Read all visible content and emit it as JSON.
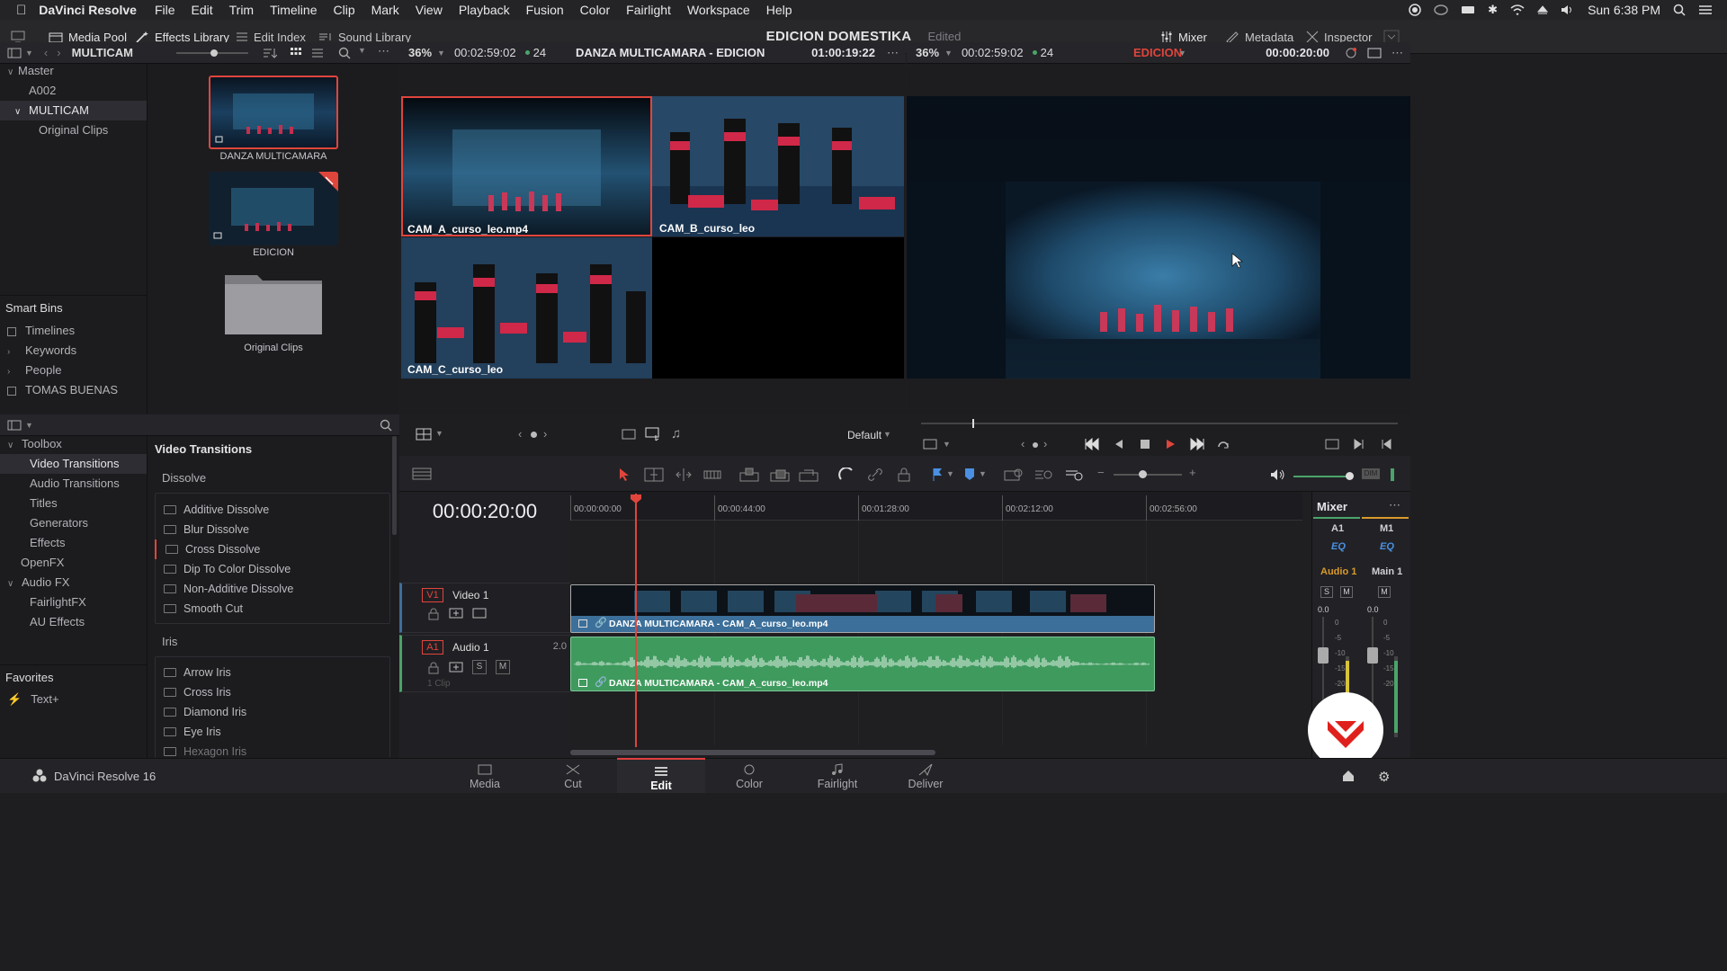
{
  "menubar": {
    "app": "DaVinci Resolve",
    "items": [
      "File",
      "Edit",
      "Trim",
      "Timeline",
      "Clip",
      "Mark",
      "View",
      "Playback",
      "Fusion",
      "Color",
      "Fairlight",
      "Workspace",
      "Help"
    ],
    "clock": "Sun 6:38 PM"
  },
  "toolbar": {
    "media_pool": "Media Pool",
    "effects_library": "Effects Library",
    "edit_index": "Edit Index",
    "sound_library": "Sound Library",
    "project_title": "EDICION DOMESTIKA",
    "project_status": "Edited",
    "mixer": "Mixer",
    "metadata": "Metadata",
    "inspector": "Inspector"
  },
  "media_pool": {
    "bin_name": "MULTICAM",
    "tree": [
      {
        "label": "Master"
      },
      {
        "label": "A002"
      },
      {
        "label": "MULTICAM"
      },
      {
        "label": "Original Clips"
      }
    ],
    "smart_bins_title": "Smart Bins",
    "smart_bins": [
      "Timelines",
      "Keywords",
      "People",
      "TOMAS BUENAS"
    ],
    "clips": [
      "DANZA MULTICAMARA",
      "EDICION",
      "Original Clips"
    ]
  },
  "source_viewer": {
    "zoom": "36%",
    "timecode": "00:02:59:02",
    "fps": "24",
    "title": "DANZA MULTICAMARA - EDICION",
    "tc_right": "01:00:19:22",
    "angles": [
      "CAM_A_curso_leo.mp4",
      "CAM_B_curso_leo",
      "CAM_C_curso_leo"
    ]
  },
  "timeline_viewer": {
    "zoom": "36%",
    "timecode": "00:02:59:02",
    "fps": "24",
    "timeline_name": "EDICION",
    "tc_right": "00:00:20:00",
    "layout_preset": "Default"
  },
  "effects": {
    "tree": [
      {
        "label": "Toolbox"
      },
      {
        "label": "Video Transitions"
      },
      {
        "label": "Audio Transitions"
      },
      {
        "label": "Titles"
      },
      {
        "label": "Generators"
      },
      {
        "label": "Effects"
      },
      {
        "label": "OpenFX"
      },
      {
        "label": "Audio FX"
      },
      {
        "label": "FairlightFX"
      },
      {
        "label": "AU Effects"
      }
    ],
    "favorites_title": "Favorites",
    "favorites": [
      "Text+"
    ],
    "section_title": "Video Transitions",
    "dissolve_title": "Dissolve",
    "dissolve": [
      "Additive Dissolve",
      "Blur Dissolve",
      "Cross Dissolve",
      "Dip To Color Dissolve",
      "Non-Additive Dissolve",
      "Smooth Cut"
    ],
    "iris_title": "Iris",
    "iris": [
      "Arrow Iris",
      "Cross Iris",
      "Diamond Iris",
      "Eye Iris",
      "Hexagon Iris"
    ]
  },
  "timeline": {
    "timecode": "00:00:20:00",
    "ruler": [
      "00:00:00:00",
      "00:00:44:00",
      "00:01:28:00",
      "00:02:12:00",
      "00:02:56:00"
    ],
    "v1_tag": "V1",
    "v1_name": "Video 1",
    "a1_tag": "A1",
    "a1_name": "Audio 1",
    "a1_level": "2.0",
    "clip_count": "1 Clip",
    "video_clip": "DANZA MULTICAMARA - CAM_A_curso_leo.mp4",
    "audio_clip": "DANZA MULTICAMARA - CAM_A_curso_leo.mp4"
  },
  "mixer": {
    "title": "Mixer",
    "ch1": "A1",
    "ch2": "M1",
    "eq": "EQ",
    "ch1_name": "Audio 1",
    "ch2_name": "Main 1",
    "s": "S",
    "m": "M",
    "val1": "0.0",
    "val2": "0.0",
    "scale": [
      "0",
      "-5",
      "-10",
      "-15",
      "-20"
    ]
  },
  "pages": [
    "Media",
    "Cut",
    "Edit",
    "Color",
    "Fairlight",
    "Deliver"
  ],
  "active_page": "Edit",
  "footer_app": "DaVinci Resolve 16",
  "colors": {
    "accent": "#e0453c",
    "audio": "#4ba46a",
    "video_clip": "#3c6f9a"
  }
}
